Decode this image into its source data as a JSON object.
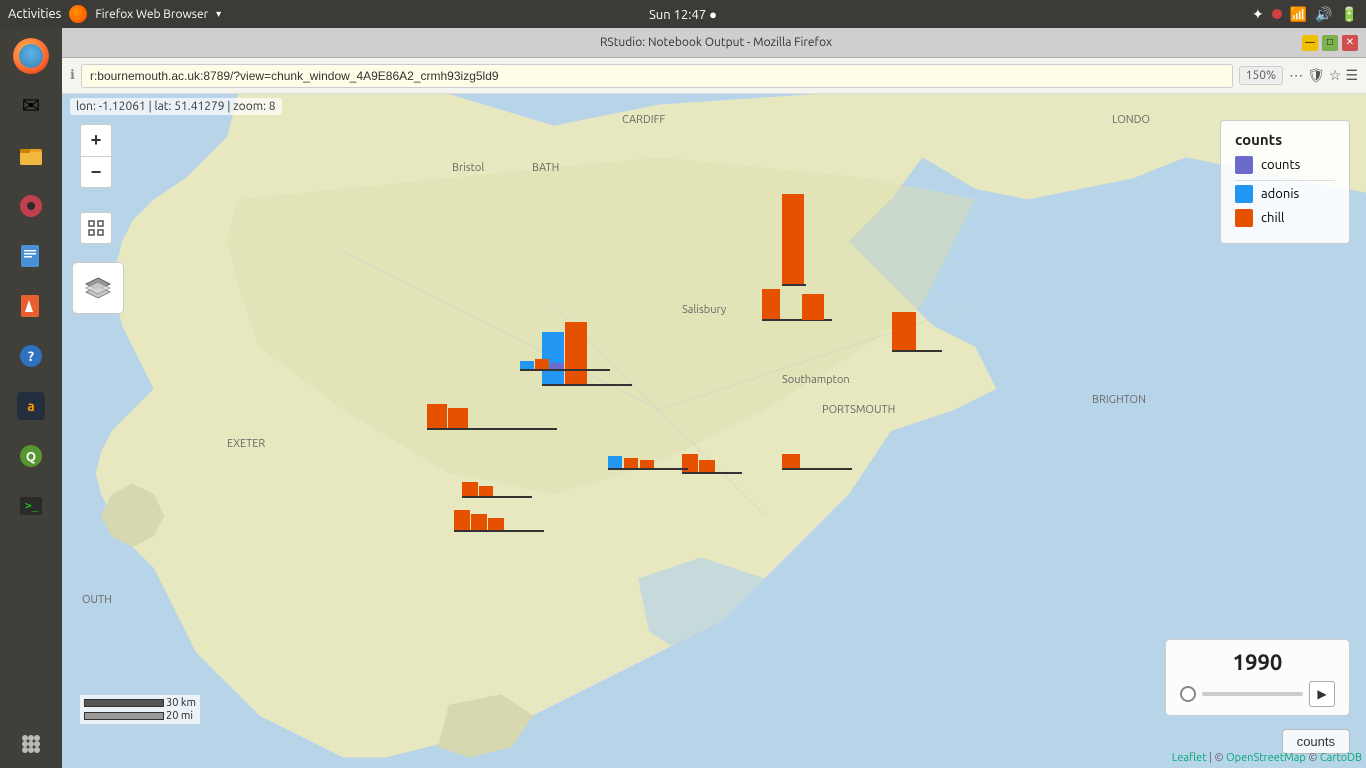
{
  "os": {
    "topbar": {
      "activities": "Activities",
      "browser_name": "Firefox Web Browser",
      "time": "Sun 12:47 ●",
      "zoom": "150%"
    }
  },
  "browser": {
    "title": "RStudio: Notebook Output - Mozilla Firefox",
    "url": "r:bournemouth.ac.uk:8789/?view=chunk_window_4A9E86A2_crmh93izg5ld9",
    "zoom": "150%",
    "window_controls": {
      "minimize": "—",
      "maximize": "□",
      "close": "✕"
    }
  },
  "map": {
    "coords": "lon: -1.12061 | lat: 51.41279 | zoom: 8",
    "zoom_in": "+",
    "zoom_out": "−",
    "year": "1990",
    "legend": {
      "title": "counts",
      "items": [
        {
          "label": "counts",
          "color": "#6b6bcc"
        },
        {
          "label": "adonis",
          "color": "#2196f3"
        },
        {
          "label": "chill",
          "color": "#e65100"
        }
      ]
    },
    "places": [
      "CARDIFF",
      "Bristol",
      "BATH",
      "Salisbury",
      "Southampton",
      "PORTSMOUTH",
      "BRIGHTON",
      "EXETER",
      "LONDO",
      "OUTH"
    ],
    "scale": {
      "km": "30 km",
      "mi": "20 mi"
    },
    "attribution": "Leaflet | © OpenStreetMap © CartoDB",
    "counts_btn": "counts",
    "play_btn": "▶"
  },
  "sidebar": {
    "icons": [
      {
        "name": "firefox",
        "symbol": "🦊"
      },
      {
        "name": "mail",
        "symbol": "✉"
      },
      {
        "name": "files",
        "symbol": "📁"
      },
      {
        "name": "music",
        "symbol": "🎵"
      },
      {
        "name": "writer",
        "symbol": "📝"
      },
      {
        "name": "draw",
        "symbol": "✏"
      },
      {
        "name": "help",
        "symbol": "❓"
      },
      {
        "name": "amazon",
        "symbol": "a"
      },
      {
        "name": "qgis",
        "symbol": "Q"
      },
      {
        "name": "terminal",
        "symbol": "⬛"
      },
      {
        "name": "apps",
        "symbol": "⋯"
      }
    ]
  }
}
